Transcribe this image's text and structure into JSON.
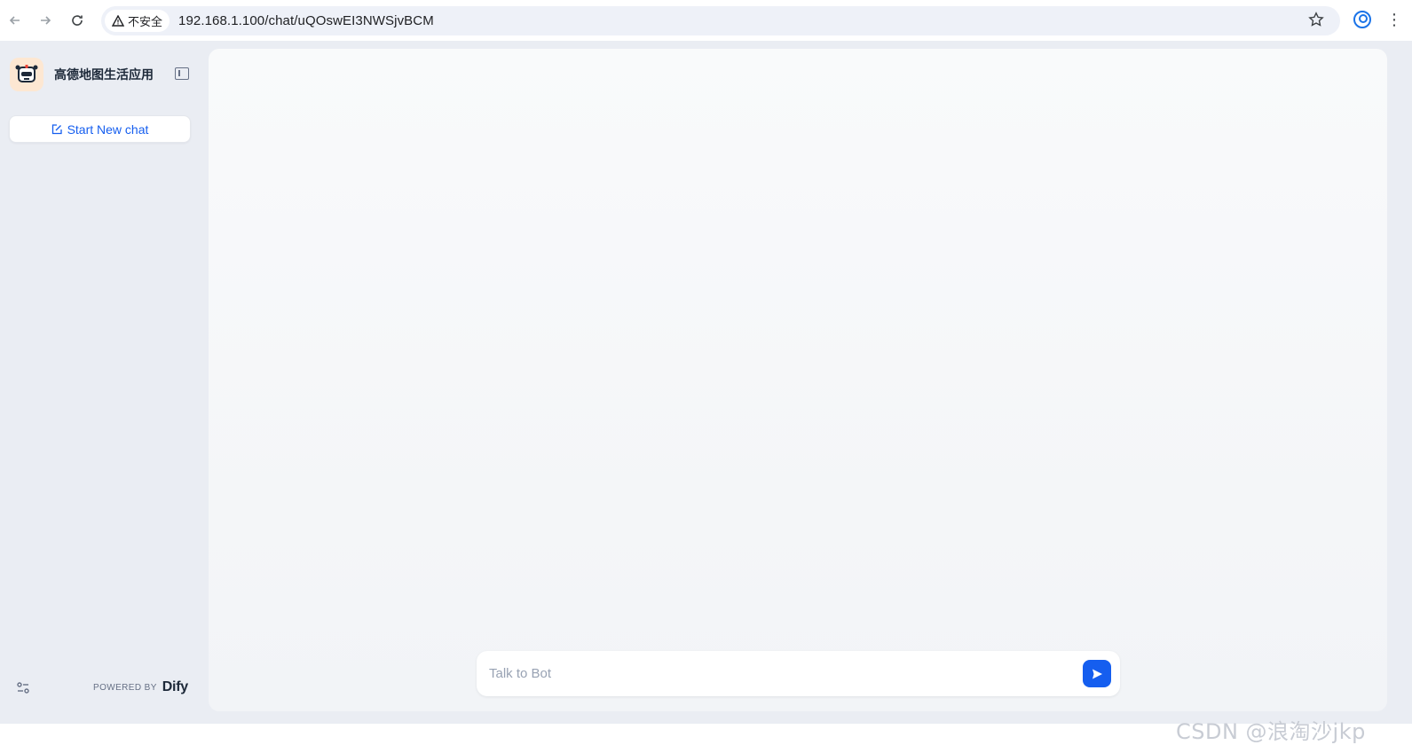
{
  "browser": {
    "back_icon": "arrow-left-icon",
    "forward_icon": "arrow-right-icon",
    "reload_icon": "reload-icon",
    "security_label": "不安全",
    "url": "192.168.1.100/chat/uQOswEI3NWSjvBCM",
    "bookmark_icon": "star-icon",
    "profile_icon": "profile-icon",
    "menu_icon": "kebab-menu-icon"
  },
  "sidebar": {
    "app_name": "高德地图生活应用",
    "new_chat_label": "Start New chat",
    "powered_by": "POWERED BY",
    "brand": "Dify"
  },
  "chat": {
    "input_placeholder": "Talk to Bot"
  },
  "watermark": "CSDN @浪淘沙jkp",
  "colors": {
    "accent": "#155eef",
    "sidebar_bg": "#eaedf3",
    "main_bg": "#f9fafb"
  }
}
